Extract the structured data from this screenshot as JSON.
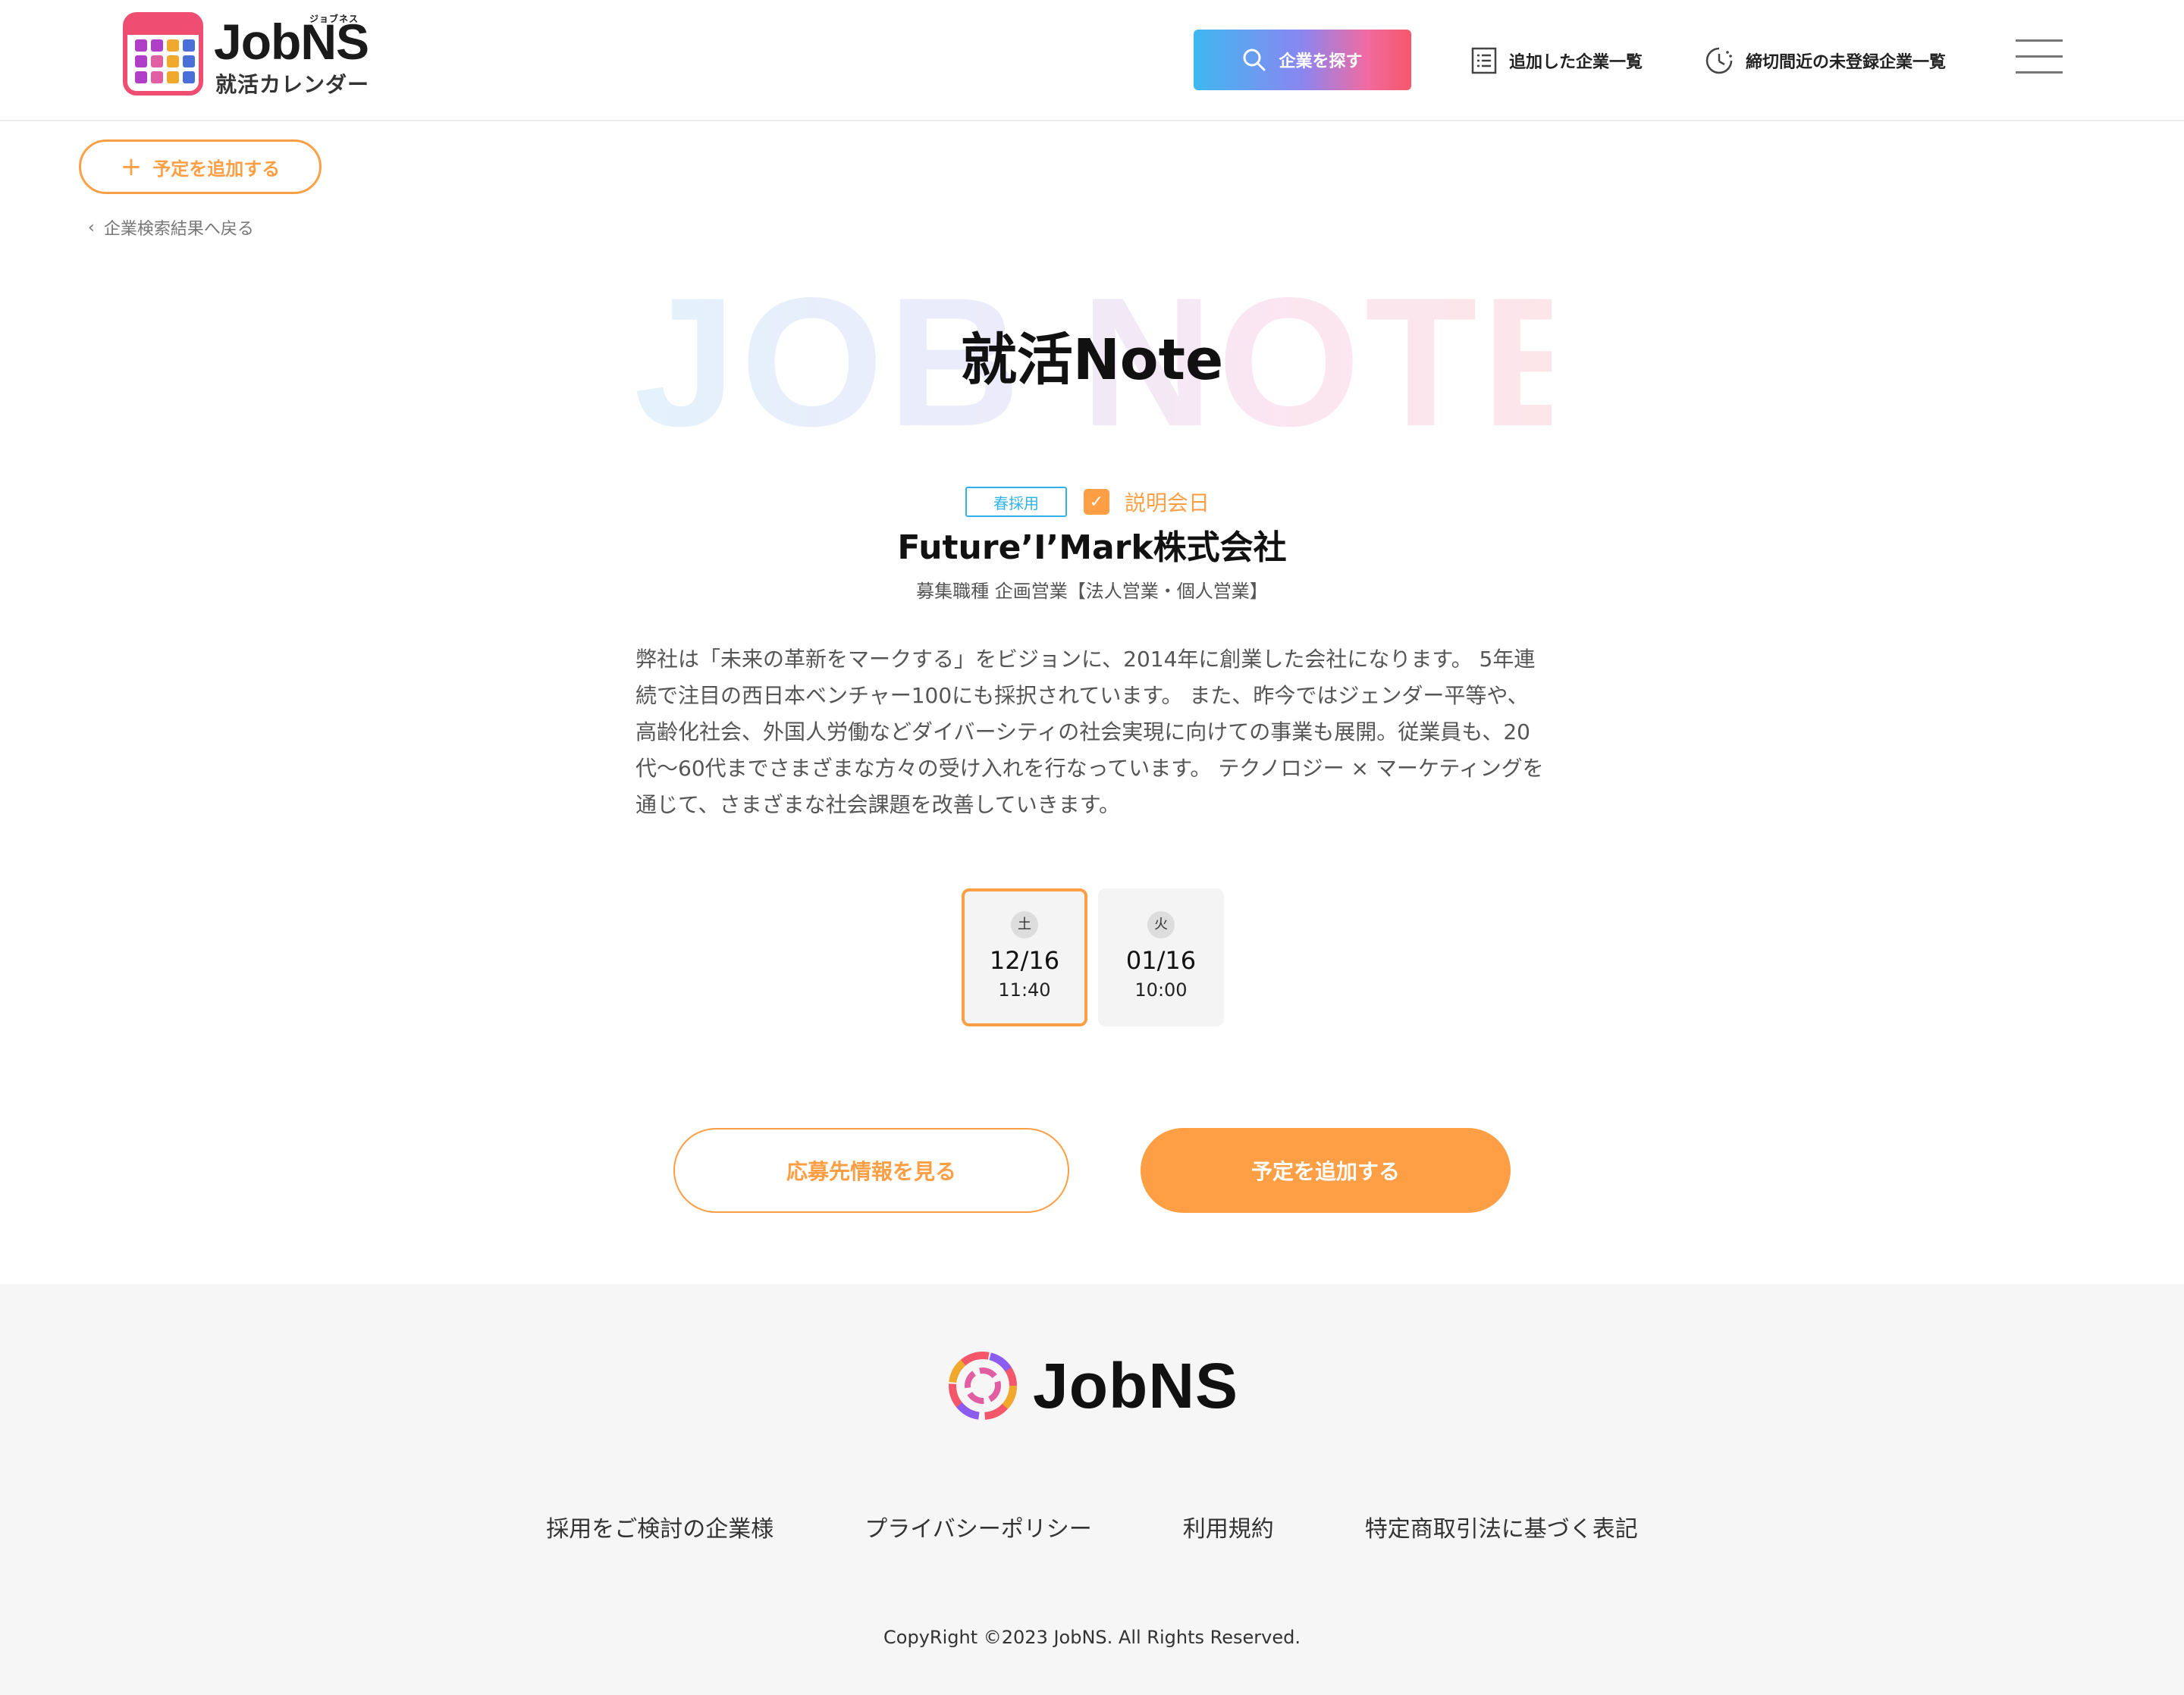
{
  "header": {
    "logo_title": "JobNS",
    "logo_ruby": "ジョブネス",
    "logo_sub": "就活カレンダー",
    "search_label": "企業を探す",
    "nav_added": "追加した企業一覧",
    "nav_deadline": "締切間近の未登録企業一覧"
  },
  "actions": {
    "add_event": "予定を追加する",
    "back": "企業検索結果へ戻る"
  },
  "hero": {
    "bg_text": "JOB NOTE",
    "title": "就活Note"
  },
  "event": {
    "tag": "春採用",
    "type": "説明会日",
    "company": "Future’I’Mark株式会社",
    "job": "募集職種 企画営業【法人営業・個人営業】",
    "description": "弊社は「未来の革新をマークする」をビジョンに、2014年に創業した会社になります。 5年連続で注目の西日本ベンチャー100にも採択されています。 また、昨今ではジェンダー平等や、高齢化社会、外国人労働などダイバーシティの社会実現に向けての事業も展開。従業員も、20代〜60代までさまざまな方々の受け入れを行なっています。 テクノロジー × マーケティングを通じて、さまざまな社会課題を改善していきます。"
  },
  "dates": [
    {
      "dow": "土",
      "md": "12/16",
      "time": "11:40",
      "selected": true
    },
    {
      "dow": "火",
      "md": "01/16",
      "time": "10:00",
      "selected": false
    }
  ],
  "buttons": {
    "view_info": "応募先情報を見る",
    "add_event": "予定を追加する"
  },
  "footer": {
    "logo": "JobNS",
    "links": [
      "採用をご検討の企業様",
      "プライバシーポリシー",
      "利用規約",
      "特定商取引法に基づく表記"
    ],
    "copyright": "CopyRight ©2023 JobNS. All Rights Reserved."
  },
  "colors": {
    "accent": "#ff9f45",
    "tag": "#30b3e6",
    "brand_pink": "#f04d72"
  },
  "icons": {
    "search": "search-icon",
    "list": "list-icon",
    "clock": "clock-icon",
    "menu": "hamburger-menu-icon",
    "calendar_check": "calendar-check-icon"
  }
}
